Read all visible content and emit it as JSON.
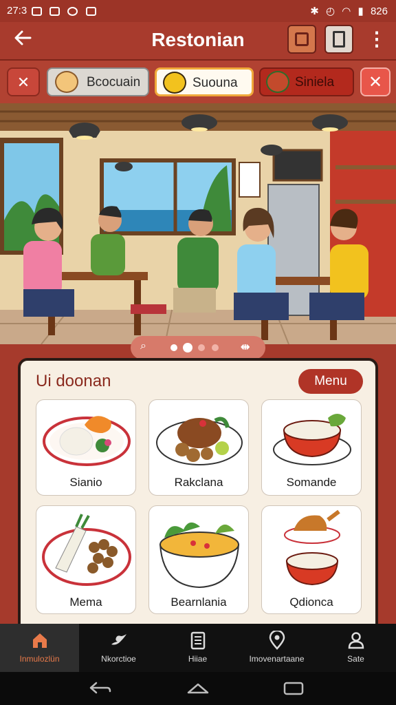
{
  "status_bar": {
    "time": "27:3",
    "battery": "826"
  },
  "app_bar": {
    "title": "Restonian",
    "back_icon": "arrow-left-icon",
    "more_icon": "more-vertical-icon"
  },
  "chips": [
    {
      "label": "Bcocuain",
      "icon": "food-bowl-icon"
    },
    {
      "label": "Suouna",
      "icon": "pasta-icon"
    },
    {
      "label": "Siniela",
      "icon": "utensils-icon"
    }
  ],
  "pager": {
    "pages": 4,
    "active": 1
  },
  "section": {
    "title": "Ui doonan",
    "menu_button": "Menu"
  },
  "dishes": [
    {
      "name": "Sianio"
    },
    {
      "name": "Rakclana"
    },
    {
      "name": "Somande"
    },
    {
      "name": "Mema"
    },
    {
      "name": "Bearnlania"
    },
    {
      "name": "Qdionca"
    }
  ],
  "bottom_nav": [
    {
      "label": "Inmulozlün",
      "icon": "home-icon",
      "active": true
    },
    {
      "label": "Nkorctioe",
      "icon": "bird-icon",
      "active": false
    },
    {
      "label": "Hiiae",
      "icon": "document-icon",
      "active": false
    },
    {
      "label": "Imovenartaane",
      "icon": "location-pin-icon",
      "active": false
    },
    {
      "label": "Sate",
      "icon": "person-icon",
      "active": false
    }
  ],
  "colors": {
    "primary": "#a83b2d",
    "accent": "#f0a93a",
    "card_bg": "#f7efe3",
    "active_nav": "#e87a4a"
  }
}
